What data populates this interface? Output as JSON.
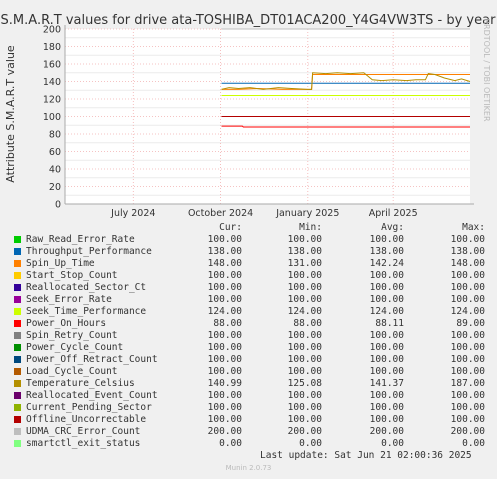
{
  "chart_data": {
    "type": "line",
    "title": "S.M.A.R.T values for drive ata-TOSHIBA_DT01ACA200_Y4G4VW3TS - by year",
    "ylabel": "Attribute S.M.A.R.T value",
    "xlabel": "",
    "watermark": "RRDTOOL / TOBI OETIKER",
    "ylim": [
      0,
      200
    ],
    "yticks": [
      0,
      20,
      40,
      60,
      80,
      100,
      120,
      140,
      160,
      180,
      200
    ],
    "xlim": [
      "2024-04-20",
      "2025-06-21"
    ],
    "xticks": [
      {
        "date": "2024-07-01",
        "label": "July 2024"
      },
      {
        "date": "2024-10-01",
        "label": "October 2024"
      },
      {
        "date": "2025-01-01",
        "label": "January 2025"
      },
      {
        "date": "2025-04-01",
        "label": "April 2025"
      }
    ],
    "grid": true,
    "series": [
      {
        "name": "Raw_Read_Error_Rate",
        "color": "#00cc00",
        "points": [
          [
            "2024-10-02",
            100
          ],
          [
            "2025-06-21",
            100
          ]
        ]
      },
      {
        "name": "Throughput_Performance",
        "color": "#0066b3",
        "points": [
          [
            "2024-10-02",
            138
          ],
          [
            "2025-06-21",
            138
          ]
        ]
      },
      {
        "name": "Spin_Up_Time",
        "color": "#ff8000",
        "points": [
          [
            "2024-10-02",
            131
          ],
          [
            "2024-10-20",
            131
          ],
          [
            "2024-11-10",
            132
          ],
          [
            "2024-12-05",
            131
          ],
          [
            "2025-01-01",
            131
          ],
          [
            "2025-01-05",
            131
          ],
          [
            "2025-01-06",
            148
          ],
          [
            "2025-06-21",
            148
          ]
        ]
      },
      {
        "name": "Start_Stop_Count",
        "color": "#ffcc00",
        "points": [
          [
            "2024-10-02",
            100
          ],
          [
            "2025-06-21",
            100
          ]
        ]
      },
      {
        "name": "Reallocated_Sector_Ct",
        "color": "#330099",
        "points": [
          [
            "2024-10-02",
            100
          ],
          [
            "2025-06-21",
            100
          ]
        ]
      },
      {
        "name": "Seek_Error_Rate",
        "color": "#990099",
        "points": [
          [
            "2024-10-02",
            100
          ],
          [
            "2025-06-21",
            100
          ]
        ]
      },
      {
        "name": "Seek_Time_Performance",
        "color": "#ccff00",
        "points": [
          [
            "2024-10-02",
            124
          ],
          [
            "2025-06-21",
            124
          ]
        ]
      },
      {
        "name": "Power_On_Hours",
        "color": "#ff0000",
        "points": [
          [
            "2024-10-02",
            89
          ],
          [
            "2024-10-24",
            89
          ],
          [
            "2024-10-25",
            88
          ],
          [
            "2025-06-21",
            88
          ]
        ]
      },
      {
        "name": "Spin_Retry_Count",
        "color": "#808080",
        "points": [
          [
            "2024-10-02",
            100
          ],
          [
            "2025-06-21",
            100
          ]
        ]
      },
      {
        "name": "Power_Cycle_Count",
        "color": "#008f00",
        "points": [
          [
            "2024-10-02",
            100
          ],
          [
            "2025-06-21",
            100
          ]
        ]
      },
      {
        "name": "Power_Off_Retract_Count",
        "color": "#00487d",
        "points": [
          [
            "2024-10-02",
            100
          ],
          [
            "2025-06-21",
            100
          ]
        ]
      },
      {
        "name": "Load_Cycle_Count",
        "color": "#b35a00",
        "points": [
          [
            "2024-10-02",
            100
          ],
          [
            "2025-06-21",
            100
          ]
        ]
      },
      {
        "name": "Temperature_Celsius",
        "color": "#b38f00",
        "points": [
          [
            "2024-10-02",
            131
          ],
          [
            "2024-10-10",
            133
          ],
          [
            "2024-10-20",
            132
          ],
          [
            "2024-11-01",
            133
          ],
          [
            "2024-11-15",
            131
          ],
          [
            "2024-12-01",
            133
          ],
          [
            "2024-12-15",
            132
          ],
          [
            "2025-01-01",
            131
          ],
          [
            "2025-01-05",
            131
          ],
          [
            "2025-01-06",
            150
          ],
          [
            "2025-01-20",
            149
          ],
          [
            "2025-02-01",
            150
          ],
          [
            "2025-02-15",
            149
          ],
          [
            "2025-03-01",
            150
          ],
          [
            "2025-03-10",
            142
          ],
          [
            "2025-03-20",
            141
          ],
          [
            "2025-04-01",
            142
          ],
          [
            "2025-04-15",
            141
          ],
          [
            "2025-04-25",
            142
          ],
          [
            "2025-05-05",
            142
          ],
          [
            "2025-05-08",
            149
          ],
          [
            "2025-05-15",
            148
          ],
          [
            "2025-05-25",
            144
          ],
          [
            "2025-06-05",
            141
          ],
          [
            "2025-06-12",
            143
          ],
          [
            "2025-06-21",
            140
          ]
        ]
      },
      {
        "name": "Reallocated_Event_Count",
        "color": "#6b006b",
        "points": [
          [
            "2024-10-02",
            100
          ],
          [
            "2025-06-21",
            100
          ]
        ]
      },
      {
        "name": "Current_Pending_Sector",
        "color": "#8fb300",
        "points": [
          [
            "2024-10-02",
            100
          ],
          [
            "2025-06-21",
            100
          ]
        ]
      },
      {
        "name": "Offline_Uncorrectable",
        "color": "#b30000",
        "points": [
          [
            "2024-10-02",
            100
          ],
          [
            "2025-06-21",
            100
          ]
        ]
      },
      {
        "name": "UDMA_CRC_Error_Count",
        "color": "#bebebe",
        "points": [
          [
            "2024-10-02",
            200
          ],
          [
            "2025-06-21",
            200
          ]
        ]
      },
      {
        "name": "smartctl_exit_status",
        "color": "#80ff80",
        "points": [
          [
            "2024-04-20",
            0
          ],
          [
            "2025-06-21",
            0
          ]
        ]
      }
    ]
  },
  "legend": {
    "headers": {
      "cur": "Cur:",
      "min": "Min:",
      "avg": "Avg:",
      "max": "Max:"
    },
    "rows": [
      {
        "name": "Raw_Read_Error_Rate",
        "color": "#00cc00",
        "cur": "100.00",
        "min": "100.00",
        "avg": "100.00",
        "max": "100.00"
      },
      {
        "name": "Throughput_Performance",
        "color": "#0066b3",
        "cur": "138.00",
        "min": "138.00",
        "avg": "138.00",
        "max": "138.00"
      },
      {
        "name": "Spin_Up_Time",
        "color": "#ff8000",
        "cur": "148.00",
        "min": "131.00",
        "avg": "142.24",
        "max": "148.00"
      },
      {
        "name": "Start_Stop_Count",
        "color": "#ffcc00",
        "cur": "100.00",
        "min": "100.00",
        "avg": "100.00",
        "max": "100.00"
      },
      {
        "name": "Reallocated_Sector_Ct",
        "color": "#330099",
        "cur": "100.00",
        "min": "100.00",
        "avg": "100.00",
        "max": "100.00"
      },
      {
        "name": "Seek_Error_Rate",
        "color": "#990099",
        "cur": "100.00",
        "min": "100.00",
        "avg": "100.00",
        "max": "100.00"
      },
      {
        "name": "Seek_Time_Performance",
        "color": "#ccff00",
        "cur": "124.00",
        "min": "124.00",
        "avg": "124.00",
        "max": "124.00"
      },
      {
        "name": "Power_On_Hours",
        "color": "#ff0000",
        "cur": "88.00",
        "min": "88.00",
        "avg": "88.11",
        "max": "89.00"
      },
      {
        "name": "Spin_Retry_Count",
        "color": "#808080",
        "cur": "100.00",
        "min": "100.00",
        "avg": "100.00",
        "max": "100.00"
      },
      {
        "name": "Power_Cycle_Count",
        "color": "#008f00",
        "cur": "100.00",
        "min": "100.00",
        "avg": "100.00",
        "max": "100.00"
      },
      {
        "name": "Power_Off_Retract_Count",
        "color": "#00487d",
        "cur": "100.00",
        "min": "100.00",
        "avg": "100.00",
        "max": "100.00"
      },
      {
        "name": "Load_Cycle_Count",
        "color": "#b35a00",
        "cur": "100.00",
        "min": "100.00",
        "avg": "100.00",
        "max": "100.00"
      },
      {
        "name": "Temperature_Celsius",
        "color": "#b38f00",
        "cur": "140.99",
        "min": "125.08",
        "avg": "141.37",
        "max": "187.00"
      },
      {
        "name": "Reallocated_Event_Count",
        "color": "#6b006b",
        "cur": "100.00",
        "min": "100.00",
        "avg": "100.00",
        "max": "100.00"
      },
      {
        "name": "Current_Pending_Sector",
        "color": "#8fb300",
        "cur": "100.00",
        "min": "100.00",
        "avg": "100.00",
        "max": "100.00"
      },
      {
        "name": "Offline_Uncorrectable",
        "color": "#b30000",
        "cur": "100.00",
        "min": "100.00",
        "avg": "100.00",
        "max": "100.00"
      },
      {
        "name": "UDMA_CRC_Error_Count",
        "color": "#bebebe",
        "cur": "200.00",
        "min": "200.00",
        "avg": "200.00",
        "max": "200.00"
      },
      {
        "name": "smartctl_exit_status",
        "color": "#80ff80",
        "cur": "0.00",
        "min": "0.00",
        "avg": "0.00",
        "max": "0.00"
      }
    ]
  },
  "footer": {
    "last_update": "Last update: Sat Jun 21 02:00:36 2025",
    "generator": "Munin 2.0.73"
  }
}
